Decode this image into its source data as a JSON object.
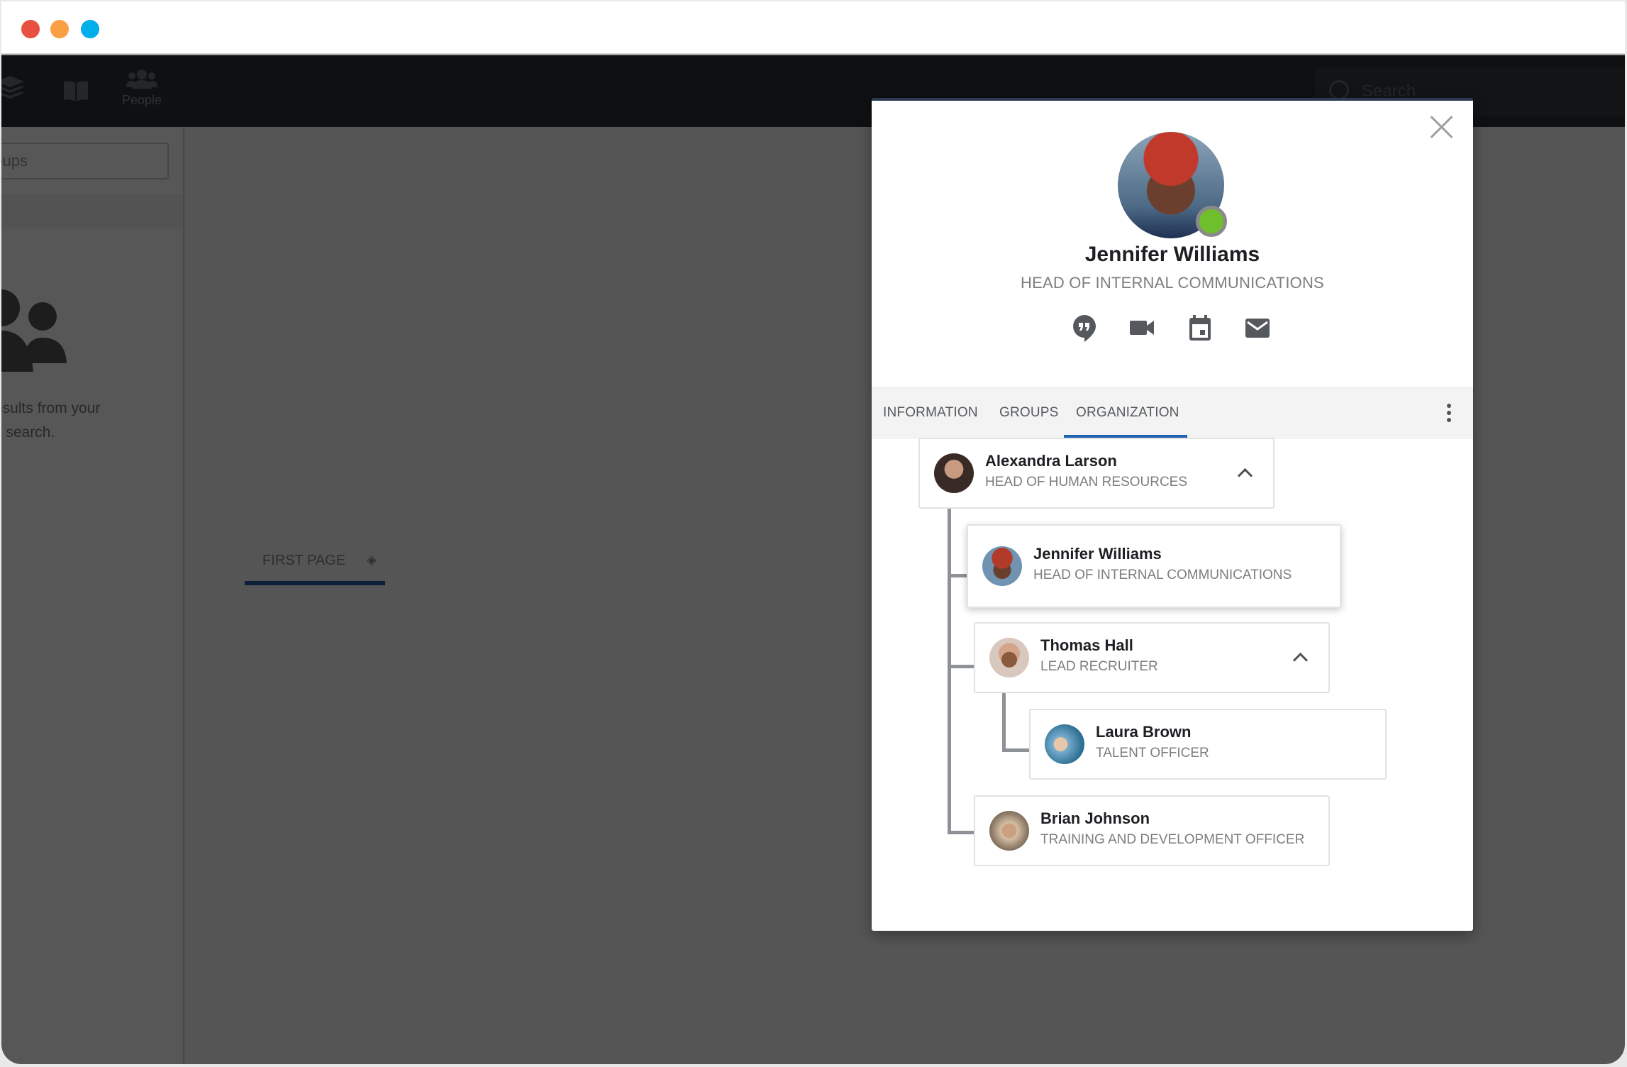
{
  "window": {
    "traffic_lights": [
      {
        "name": "close",
        "color": "#e8513f"
      },
      {
        "name": "minimize",
        "color": "#f8a043"
      },
      {
        "name": "maximize",
        "color": "#00aeea"
      }
    ]
  },
  "topnav": {
    "items": [
      {
        "icon": "layers-icon",
        "label": ""
      },
      {
        "icon": "book-icon",
        "label": ""
      },
      {
        "icon": "people-icon",
        "label": "People"
      }
    ],
    "search_placeholder": "Search"
  },
  "sidebar": {
    "search_value": "roups",
    "empty_text_line1": "esults from your",
    "empty_text_line2": "s search."
  },
  "content": {
    "page_tab_label": "FIRST PAGE"
  },
  "profile": {
    "name": "Jennifer Williams",
    "title": "HEAD OF INTERNAL COMMUNICATIONS",
    "status": "online",
    "status_color": "#6fbf2d",
    "actions": [
      {
        "icon": "chat-quote-icon",
        "label": "Chat"
      },
      {
        "icon": "video-camera-icon",
        "label": "Video call"
      },
      {
        "icon": "calendar-icon",
        "label": "Calendar"
      },
      {
        "icon": "mail-icon",
        "label": "Email"
      }
    ],
    "tabs": [
      {
        "label": "INFORMATION",
        "active": false
      },
      {
        "label": "GROUPS",
        "active": false
      },
      {
        "label": "ORGANIZATION",
        "active": true
      }
    ],
    "accent_color": "#1f63b0"
  },
  "organization": {
    "nodes": [
      {
        "name": "Alexandra Larson",
        "title": "HEAD OF HUMAN RESOURCES",
        "expanded": true,
        "level": 0
      },
      {
        "name": "Jennifer Williams",
        "title": "HEAD OF INTERNAL COMMUNICATIONS",
        "selected": true,
        "level": 1
      },
      {
        "name": "Thomas Hall",
        "title": "LEAD RECRUITER",
        "expanded": true,
        "level": 1
      },
      {
        "name": "Laura Brown",
        "title": "TALENT OFFICER",
        "level": 2
      },
      {
        "name": "Brian Johnson",
        "title": "TRAINING AND DEVELOPMENT OFFICER",
        "level": 1
      }
    ]
  }
}
